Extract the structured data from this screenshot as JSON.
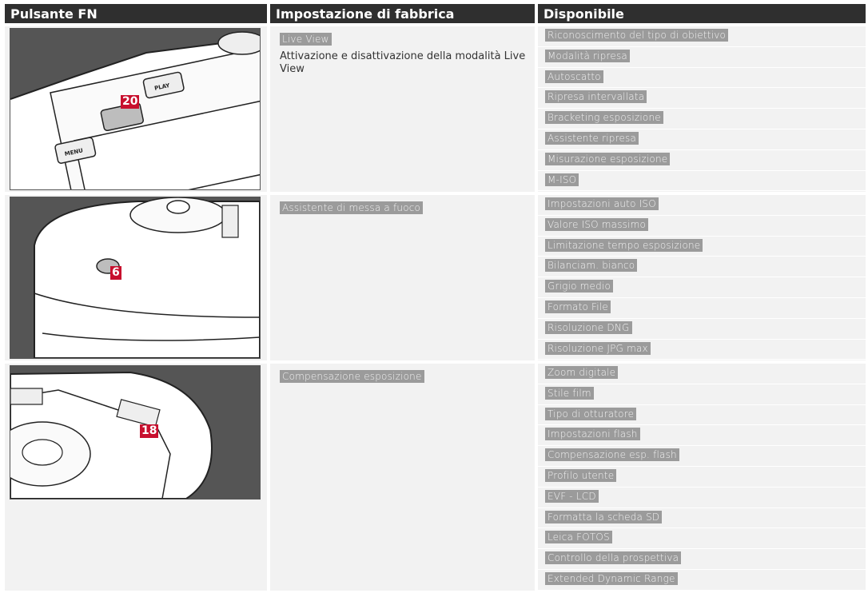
{
  "table": {
    "headers": [
      "Pulsante FN",
      "Impostazione di fabbrica",
      "Disponibile"
    ],
    "rows": [
      {
        "badge": "20",
        "factory_tag": "Live View",
        "factory_desc": "Attivazione e disattivazione della modalità Live View",
        "image_labels": {
          "menu": "MENU",
          "play": "PLAY"
        },
        "available": [
          "Riconoscimento del tipo di obiettivo",
          "Modalità ripresa",
          "Autoscatto",
          "Ripresa intervallata",
          "Bracketing esposizione",
          "Assistente ripresa",
          "Misurazione esposizione",
          "M-ISO"
        ]
      },
      {
        "badge": "6",
        "factory_tag": "Assistente di messa a fuoco",
        "factory_desc": "",
        "available": [
          "Impostazioni auto ISO",
          "Valore ISO massimo",
          "Limitazione tempo esposizione",
          "Bilanciam. bianco",
          "Grigio medio",
          "Formato File",
          "Risoluzione DNG",
          "Risoluzione JPG max"
        ]
      },
      {
        "badge": "18",
        "factory_tag": "Compensazione esposizione",
        "factory_desc": "",
        "available": [
          "Zoom digitale",
          "Stile film",
          "Tipo di otturatore",
          "Impostazioni flash",
          "Compensazione esp. flash",
          "Profilo utente",
          "EVF - LCD",
          "Formatta la scheda SD",
          "Leica FOTOS",
          "Controllo della prospettiva",
          "Extended Dynamic Range"
        ]
      }
    ]
  },
  "colors": {
    "header_bg": "#2f2f2f",
    "row_bg": "#f2f2f2",
    "tag_bg": "#9b9b9b",
    "badge": "#c8102e"
  }
}
